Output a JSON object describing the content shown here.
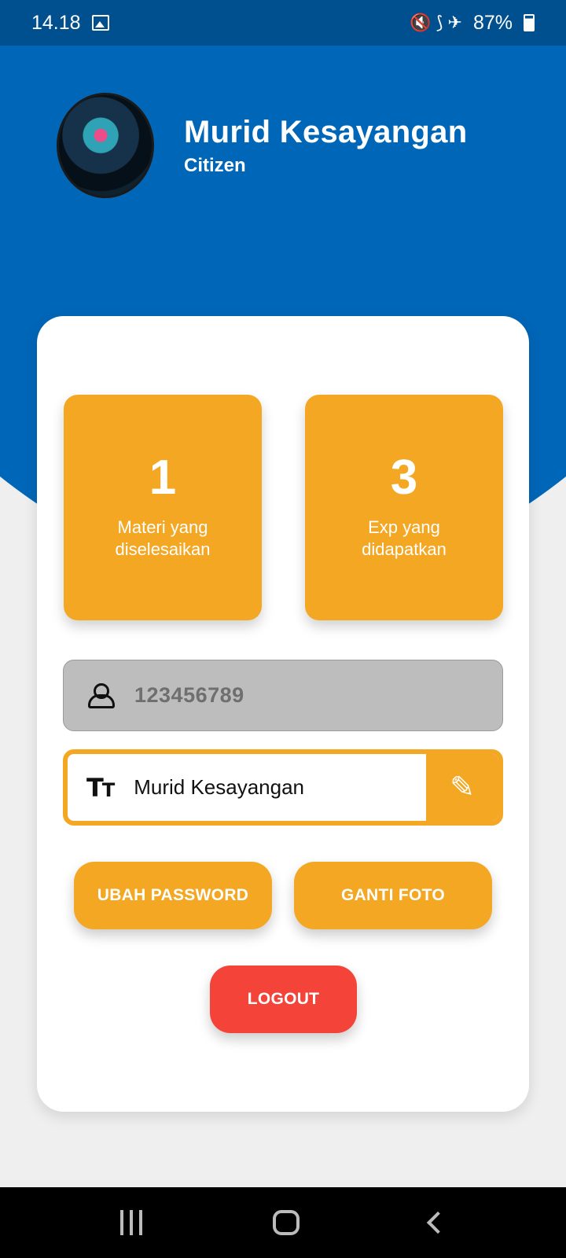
{
  "status_bar": {
    "time": "14.18",
    "status_icons": "🔇 ⟆ ✈",
    "battery": "87%"
  },
  "profile": {
    "name": "Murid Kesayangan",
    "role": "Citizen"
  },
  "stats": [
    {
      "value": "1",
      "label": "Materi yang diselesaikan"
    },
    {
      "value": "3",
      "label": "Exp yang didapatkan"
    }
  ],
  "fields": {
    "user_id": "123456789",
    "display_name": "Murid Kesayangan"
  },
  "buttons": {
    "change_password": "UBAH PASSWORD",
    "change_photo": "GANTI FOTO",
    "logout": "LOGOUT"
  },
  "colors": {
    "primary_blue": "#0066b8",
    "status_bar": "#004f8e",
    "accent_orange": "#f4a723",
    "logout_red": "#f4443a"
  },
  "icons": {
    "gallery": "gallery-icon",
    "person": "person-icon",
    "text": "text-size-icon",
    "edit": "pencil-icon"
  }
}
